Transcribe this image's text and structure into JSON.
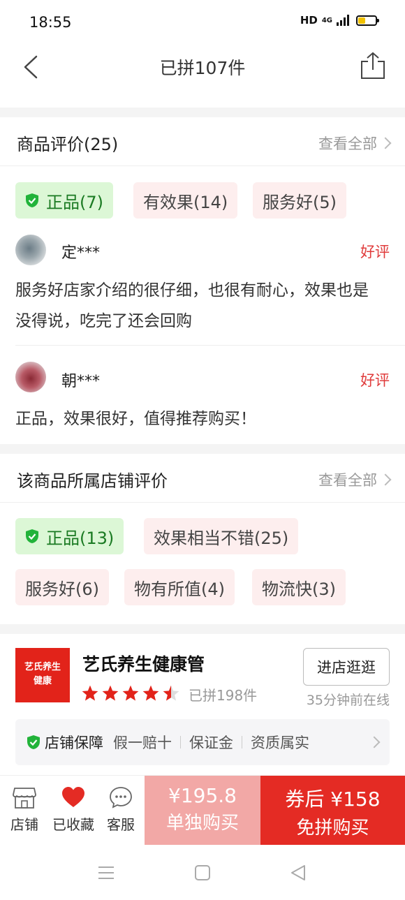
{
  "status": {
    "time": "18:55",
    "network": "HD",
    "network_type": "4G"
  },
  "nav": {
    "title": "已拼107件"
  },
  "product_reviews": {
    "title": "商品评价(25)",
    "see_all": "查看全部",
    "tags": [
      "正品(7)",
      "有效果(14)",
      "服务好(5)"
    ],
    "reviews": [
      {
        "name": "定***",
        "rating": "好评",
        "text": "服务好店家介绍的很仔细，也很有耐心，效果也是没得说，吃完了还会回购"
      },
      {
        "name": "朝***",
        "rating": "好评",
        "text": "正品，效果很好，值得推荐购买！"
      }
    ]
  },
  "store_reviews": {
    "title": "该商品所属店铺评价",
    "see_all": "查看全部",
    "tags": [
      "正品(13)",
      "效果相当不错(25)",
      "服务好(6)",
      "物有所值(4)",
      "物流快(3)"
    ]
  },
  "store": {
    "logo_text_line1": "艺氏养生",
    "logo_text_line2": "健康",
    "name": "艺氏养生健康管",
    "rating": 4.5,
    "sold": "已拼198件",
    "visit": "进店逛逛",
    "online": "35分钟前在线",
    "guarantee_title": "店铺保障",
    "guarantees": [
      "假一赔十",
      "保证金",
      "资质属实"
    ]
  },
  "bottom_bar": {
    "store_label": "店铺",
    "favorite_label": "已收藏",
    "service_label": "客服",
    "solo_price": "¥195.8",
    "solo_label": "单独购买",
    "group_price": "券后 ¥158",
    "group_label": "免拼购买"
  },
  "colors": {
    "accent": "#e42b24",
    "green": "#1a7a22",
    "muted": "#999999"
  }
}
